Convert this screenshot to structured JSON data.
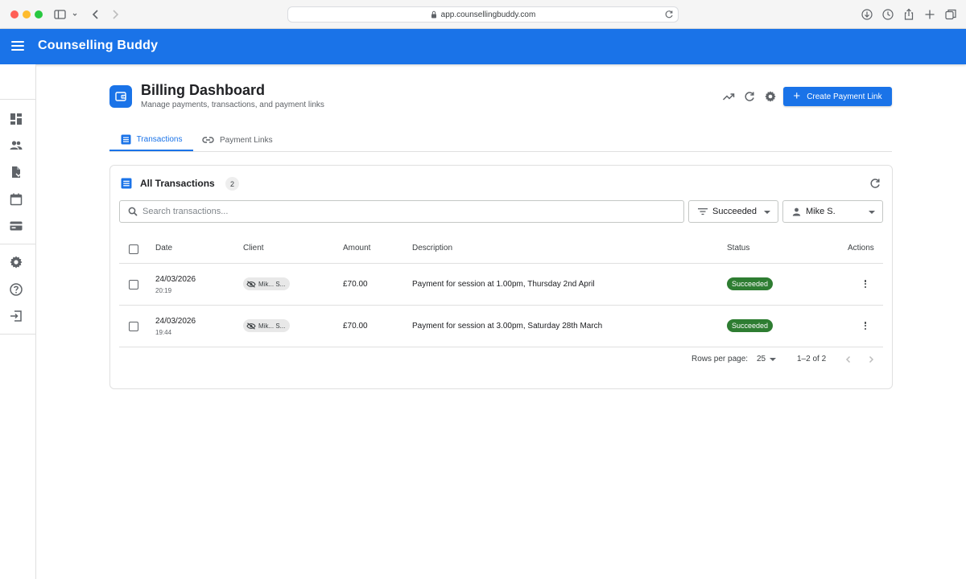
{
  "browser": {
    "url": "app.counsellingbuddy.com"
  },
  "app": {
    "brand": "Counselling Buddy"
  },
  "sidebar": {
    "items": [
      {
        "icon": "dashboard-icon"
      },
      {
        "icon": "clients-icon"
      },
      {
        "icon": "documents-icon"
      },
      {
        "icon": "calendar-icon"
      },
      {
        "icon": "billing-icon"
      },
      {
        "icon": "settings-icon"
      },
      {
        "icon": "help-icon"
      },
      {
        "icon": "logout-icon"
      }
    ]
  },
  "page": {
    "title": "Billing Dashboard",
    "subtitle": "Manage payments, transactions, and payment links",
    "create_button": "Create Payment Link",
    "accent": "#1a73e8"
  },
  "tabs": [
    {
      "label": "Transactions",
      "active": true
    },
    {
      "label": "Payment Links",
      "active": false
    }
  ],
  "transactions": {
    "title": "All Transactions",
    "count": "2",
    "search_placeholder": "Search transactions...",
    "status_filter": "Succeeded",
    "client_filter": "Mike S.",
    "columns": [
      "Date",
      "Client",
      "Amount",
      "Description",
      "Status",
      "Actions"
    ],
    "rows": [
      {
        "date": "24/03/2026",
        "time": "20:19",
        "client": "Mik... S...",
        "amount": "£70.00",
        "description": "Payment for session at 1.00pm, Thursday 2nd April",
        "status": "Succeeded"
      },
      {
        "date": "24/03/2026",
        "time": "19:44",
        "client": "Mik... S...",
        "amount": "£70.00",
        "description": "Payment for session at 3.00pm, Saturday 28th March",
        "status": "Succeeded"
      }
    ],
    "status_color": "#2e7d32",
    "pagination": {
      "rows_per_page_label": "Rows per page:",
      "rows_per_page": "25",
      "range": "1–2 of 2"
    }
  }
}
